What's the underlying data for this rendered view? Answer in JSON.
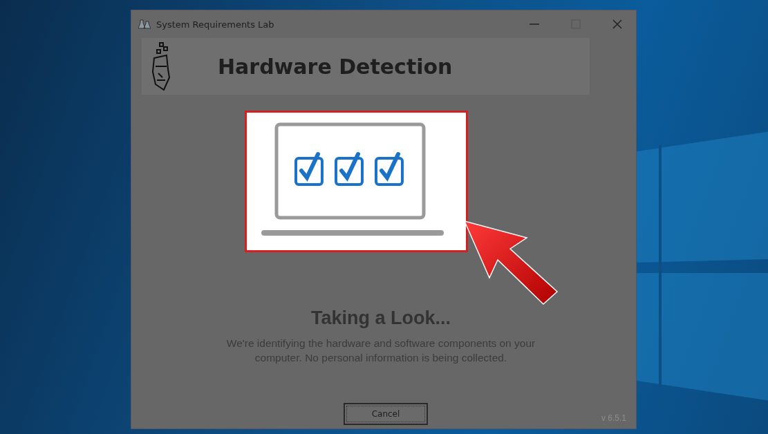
{
  "window": {
    "title": "System Requirements Lab"
  },
  "header": {
    "title": "Hardware Detection"
  },
  "status": {
    "heading": "Taking a Look...",
    "description": "We're identifying the hardware and software components on your computer. No personal information is being collected."
  },
  "footer": {
    "button": "Cancel",
    "version": "v 6.5.1"
  }
}
